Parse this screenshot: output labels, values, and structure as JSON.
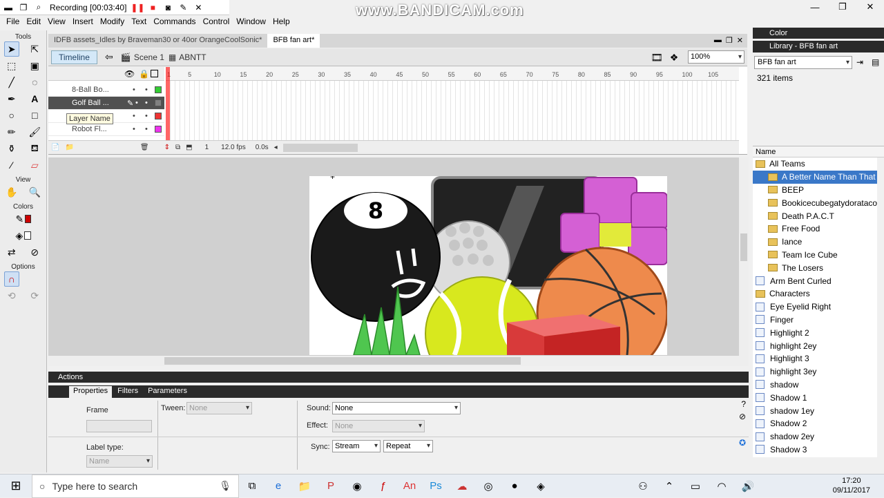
{
  "recorder": {
    "status": "Recording [00:03:40]",
    "watermark": "www.BANDICAM.com"
  },
  "menubar": [
    "File",
    "Edit",
    "View",
    "Insert",
    "Modify",
    "Text",
    "Commands",
    "Control",
    "Window",
    "Help"
  ],
  "tools": {
    "header": "Tools",
    "view": "View",
    "colors": "Colors",
    "options": "Options"
  },
  "document": {
    "tabs": [
      "IDFB assets_Idles by Braveman30 or 40or OrangeCoolSonic*",
      "BFB fan art*"
    ],
    "timeline_button": "Timeline",
    "scene": "Scene 1",
    "symbol": "ABNTT",
    "zoom": "100%"
  },
  "timeline": {
    "layers": [
      {
        "name": "8-Ball Bo...",
        "color": "#33cc33"
      },
      {
        "name": "Golf Ball ...",
        "color": "#808080"
      },
      {
        "name": "",
        "color": "#ee3333"
      },
      {
        "name": "Robot Fl...",
        "color": "#ee33ee"
      }
    ],
    "ticks": [
      "1",
      "5",
      "10",
      "15",
      "20",
      "25",
      "30",
      "35",
      "40",
      "45",
      "50",
      "55",
      "60",
      "65",
      "70",
      "75",
      "80",
      "85",
      "90",
      "95",
      "100",
      "105"
    ],
    "frame": "1",
    "fps": "12.0 fps",
    "time": "0.0s",
    "tooltip": "Layer Name"
  },
  "panels": {
    "actions": "Actions",
    "prop_tabs": [
      "Properties",
      "Filters",
      "Parameters"
    ],
    "properties": {
      "frame_label": "Frame",
      "tween_label": "Tween:",
      "tween_value": "None",
      "sound_label": "Sound:",
      "sound_value": "None",
      "effect_label": "Effect:",
      "effect_value": "None",
      "label_type_label": "Label type:",
      "label_type_value": "Name",
      "sync_label": "Sync:",
      "sync_value": "Stream",
      "repeat_value": "Repeat"
    }
  },
  "library": {
    "color_panel": "Color",
    "title": "Library - BFB fan art",
    "doc": "BFB fan art",
    "count": "321 items",
    "col_name": "Name",
    "items": [
      {
        "label": "All Teams",
        "type": "folder",
        "indent": 0
      },
      {
        "label": "A Better Name Than That",
        "type": "folder",
        "indent": 1,
        "selected": true
      },
      {
        "label": "BEEP",
        "type": "folder",
        "indent": 1
      },
      {
        "label": "Bookicecubegatydoratacoteardrop",
        "type": "folder",
        "indent": 1
      },
      {
        "label": "Death P.A.C.T",
        "type": "folder",
        "indent": 1
      },
      {
        "label": "Free Food",
        "type": "folder",
        "indent": 1
      },
      {
        "label": "Iance",
        "type": "folder",
        "indent": 1
      },
      {
        "label": "Team Ice Cube",
        "type": "folder",
        "indent": 1
      },
      {
        "label": "The Losers",
        "type": "folder",
        "indent": 1
      },
      {
        "label": "Arm Bent Curled",
        "type": "graphic",
        "indent": 0
      },
      {
        "label": "Characters",
        "type": "folder",
        "indent": 0
      },
      {
        "label": "Eye Eyelid Right",
        "type": "graphic",
        "indent": 0
      },
      {
        "label": "Finger",
        "type": "graphic",
        "indent": 0
      },
      {
        "label": "Highlight 2",
        "type": "graphic",
        "indent": 0
      },
      {
        "label": "highlight 2ey",
        "type": "graphic",
        "indent": 0
      },
      {
        "label": "Highlight 3",
        "type": "graphic",
        "indent": 0
      },
      {
        "label": "highlight 3ey",
        "type": "graphic",
        "indent": 0
      },
      {
        "label": "shadow",
        "type": "graphic",
        "indent": 0
      },
      {
        "label": "Shadow 1",
        "type": "graphic",
        "indent": 0
      },
      {
        "label": "shadow 1ey",
        "type": "graphic",
        "indent": 0
      },
      {
        "label": "Shadow 2",
        "type": "graphic",
        "indent": 0
      },
      {
        "label": "shadow 2ey",
        "type": "graphic",
        "indent": 0
      },
      {
        "label": "Shadow 3",
        "type": "graphic",
        "indent": 0
      }
    ]
  },
  "taskbar": {
    "search_placeholder": "Type here to search",
    "time": "17:20",
    "date": "09/11/2017"
  }
}
